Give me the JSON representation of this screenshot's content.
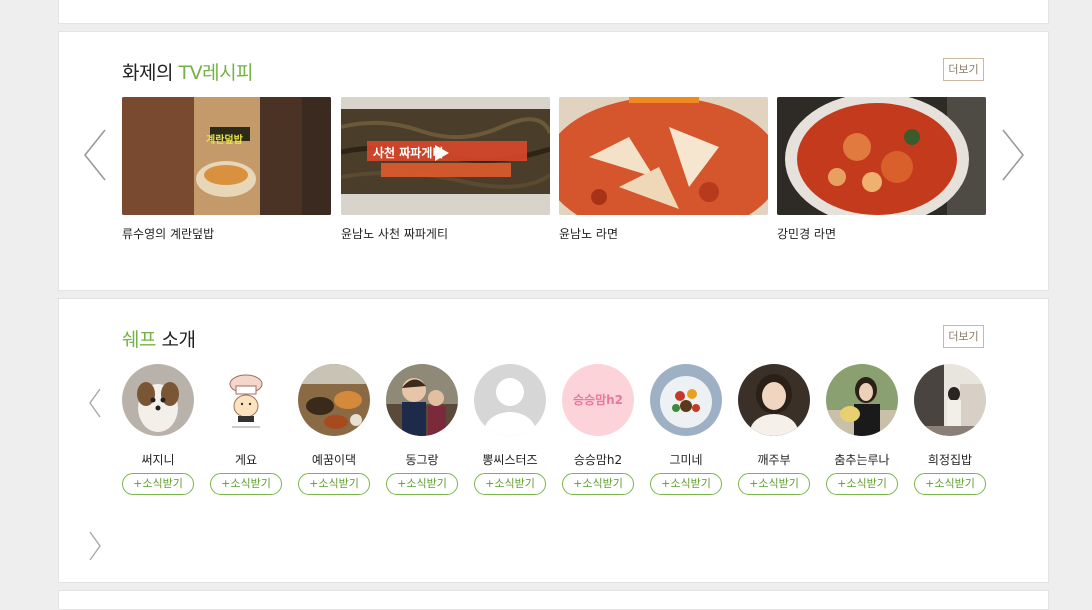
{
  "tv_section": {
    "title_prefix": "화제의 ",
    "title_accent": "TV레시피",
    "more_label": "더보기",
    "recipes": [
      {
        "name": "류수영의 계란덮밥",
        "caption": "계란덮밥"
      },
      {
        "name": "윤남노 사천 짜파게티",
        "caption": "사천 짜파게티"
      },
      {
        "name": "윤남노 라면",
        "caption": ""
      },
      {
        "name": "강민경 라면",
        "caption": ""
      }
    ]
  },
  "chef_section": {
    "title_accent": "쉐프",
    "title_suffix": " 소개",
    "more_label": "더보기",
    "subscribe_label": "+소식받기",
    "chefs": [
      {
        "name": "써지니"
      },
      {
        "name": "게요"
      },
      {
        "name": "예꿈이댁"
      },
      {
        "name": "동그랑"
      },
      {
        "name": "뽕씨스터즈"
      },
      {
        "name": "승승맘h2",
        "avatar_text": "승승맘h2"
      },
      {
        "name": "그미네"
      },
      {
        "name": "깨주부"
      },
      {
        "name": "춤추는루나"
      },
      {
        "name": "희정집밥"
      }
    ]
  },
  "colors": {
    "accent": "#74b243",
    "button_border": "#7cb548",
    "more_border": "#c9b9a3"
  }
}
